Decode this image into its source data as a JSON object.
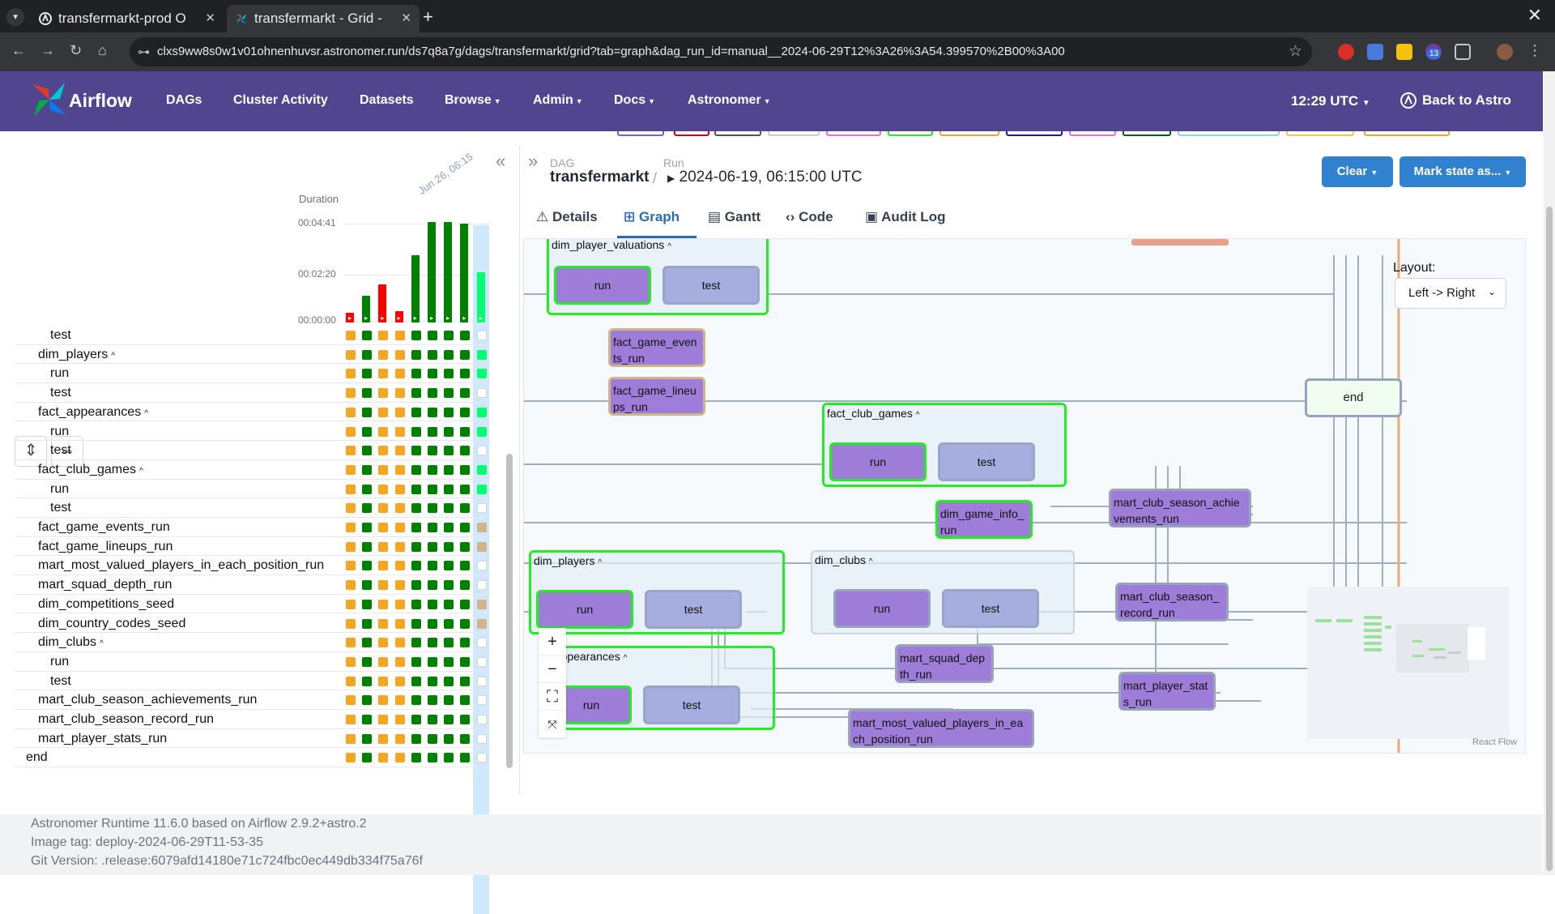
{
  "browser": {
    "tabs": [
      {
        "title": "transfermarkt-prod O"
      },
      {
        "title": "transfermarkt - Grid -"
      }
    ],
    "url": "clxs9ww8s0w1v01ohnenhuvsr.astronomer.run/ds7q8a7g/dags/transfermarkt/grid?tab=graph&dag_run_id=manual__2024-06-29T12%3A26%3A54.399570%2B00%3A00",
    "extension_badge": "13"
  },
  "nav": {
    "brand": "Airflow",
    "items": [
      "DAGs",
      "Cluster Activity",
      "Datasets",
      "Browse",
      "Admin",
      "Docs",
      "Astronomer"
    ],
    "dropdown_items": [
      "Browse",
      "Admin",
      "Docs",
      "Astronomer"
    ],
    "clock": "12:29 UTC",
    "back": "Back to Astro"
  },
  "grid": {
    "duration_label": "Duration",
    "ticks": [
      "00:04:41",
      "00:02:20",
      "00:00:00"
    ],
    "run_date": "Jun 26, 06:15",
    "bars": [
      {
        "state": "failed",
        "duration_fraction": 0.1
      },
      {
        "state": "success",
        "duration_fraction": 0.27
      },
      {
        "state": "failed",
        "duration_fraction": 0.38
      },
      {
        "state": "failed",
        "duration_fraction": 0.11
      },
      {
        "state": "success",
        "duration_fraction": 0.67
      },
      {
        "state": "success",
        "duration_fraction": 1.0
      },
      {
        "state": "success",
        "duration_fraction": 1.0
      },
      {
        "state": "success",
        "duration_fraction": 0.98
      },
      {
        "state": "running",
        "duration_fraction": 0.5
      }
    ],
    "rows": [
      {
        "label": "test",
        "indent": 2,
        "group": false,
        "states": [
          "U",
          "S",
          "U",
          "U",
          "S",
          "S",
          "S",
          "S",
          "N"
        ]
      },
      {
        "label": "dim_players",
        "indent": 1,
        "group": true,
        "states": [
          "U",
          "S",
          "U",
          "U",
          "S",
          "S",
          "S",
          "S",
          "R"
        ]
      },
      {
        "label": "run",
        "indent": 2,
        "group": false,
        "states": [
          "U",
          "S",
          "U",
          "U",
          "S",
          "S",
          "S",
          "S",
          "R"
        ]
      },
      {
        "label": "test",
        "indent": 2,
        "group": false,
        "states": [
          "U",
          "S",
          "U",
          "U",
          "S",
          "S",
          "S",
          "S",
          "N"
        ]
      },
      {
        "label": "fact_appearances",
        "indent": 1,
        "group": true,
        "states": [
          "U",
          "S",
          "U",
          "U",
          "S",
          "S",
          "S",
          "S",
          "R"
        ]
      },
      {
        "label": "run",
        "indent": 2,
        "group": false,
        "states": [
          "U",
          "S",
          "U",
          "U",
          "S",
          "S",
          "S",
          "S",
          "R"
        ]
      },
      {
        "label": "test",
        "indent": 2,
        "group": false,
        "states": [
          "U",
          "S",
          "U",
          "U",
          "S",
          "S",
          "S",
          "S",
          "N"
        ]
      },
      {
        "label": "fact_club_games",
        "indent": 1,
        "group": true,
        "states": [
          "U",
          "S",
          "U",
          "U",
          "S",
          "S",
          "S",
          "S",
          "R"
        ]
      },
      {
        "label": "run",
        "indent": 2,
        "group": false,
        "states": [
          "U",
          "S",
          "U",
          "U",
          "S",
          "S",
          "S",
          "S",
          "R"
        ]
      },
      {
        "label": "test",
        "indent": 2,
        "group": false,
        "states": [
          "U",
          "S",
          "U",
          "U",
          "S",
          "S",
          "S",
          "S",
          "N"
        ]
      },
      {
        "label": "fact_game_events_run",
        "indent": 1,
        "group": false,
        "states": [
          "U",
          "S",
          "U",
          "U",
          "S",
          "S",
          "S",
          "S",
          "T"
        ]
      },
      {
        "label": "fact_game_lineups_run",
        "indent": 1,
        "group": false,
        "states": [
          "U",
          "S",
          "U",
          "U",
          "S",
          "S",
          "S",
          "S",
          "T"
        ]
      },
      {
        "label": "mart_most_valued_players_in_each_position_run",
        "indent": 1,
        "group": false,
        "states": [
          "U",
          "S",
          "U",
          "U",
          "S",
          "S",
          "S",
          "S",
          "N"
        ]
      },
      {
        "label": "mart_squad_depth_run",
        "indent": 1,
        "group": false,
        "states": [
          "U",
          "S",
          "U",
          "U",
          "S",
          "S",
          "S",
          "S",
          "N"
        ]
      },
      {
        "label": "dim_competitions_seed",
        "indent": 1,
        "group": false,
        "states": [
          "U",
          "S",
          "U",
          "U",
          "S",
          "S",
          "S",
          "S",
          "T"
        ]
      },
      {
        "label": "dim_country_codes_seed",
        "indent": 1,
        "group": false,
        "states": [
          "U",
          "S",
          "U",
          "U",
          "S",
          "S",
          "S",
          "S",
          "T"
        ]
      },
      {
        "label": "dim_clubs",
        "indent": 1,
        "group": true,
        "states": [
          "U",
          "S",
          "U",
          "U",
          "S",
          "S",
          "S",
          "S",
          "N"
        ]
      },
      {
        "label": "run",
        "indent": 2,
        "group": false,
        "states": [
          "U",
          "S",
          "U",
          "U",
          "S",
          "S",
          "S",
          "S",
          "N"
        ]
      },
      {
        "label": "test",
        "indent": 2,
        "group": false,
        "states": [
          "U",
          "S",
          "U",
          "U",
          "S",
          "S",
          "S",
          "S",
          "N"
        ]
      },
      {
        "label": "mart_club_season_achievements_run",
        "indent": 1,
        "group": false,
        "states": [
          "U",
          "S",
          "U",
          "U",
          "S",
          "S",
          "S",
          "S",
          "N"
        ]
      },
      {
        "label": "mart_club_season_record_run",
        "indent": 1,
        "group": false,
        "states": [
          "U",
          "S",
          "U",
          "U",
          "S",
          "S",
          "S",
          "S",
          "N"
        ]
      },
      {
        "label": "mart_player_stats_run",
        "indent": 1,
        "group": false,
        "states": [
          "U",
          "S",
          "U",
          "U",
          "S",
          "S",
          "S",
          "S",
          "N"
        ]
      },
      {
        "label": "end",
        "indent": 0,
        "group": false,
        "states": [
          "U",
          "S",
          "U",
          "U",
          "S",
          "S",
          "S",
          "S",
          "N"
        ]
      }
    ]
  },
  "detail": {
    "dag_label": "DAG",
    "dag_name": "transfermarkt",
    "run_label": "Run",
    "run_value": "2024-06-19, 06:15:00 UTC",
    "clear_btn": "Clear",
    "mark_btn": "Mark state as...",
    "tabs": [
      "Details",
      "Graph",
      "Gantt",
      "Code",
      "Audit Log"
    ],
    "active_tab": "Graph"
  },
  "graph": {
    "layout_label": "Layout:",
    "layout_value": "Left -> Right",
    "groups": {
      "dim_player_valuations": "dim_player_valuations",
      "fact_club_games": "fact_club_games",
      "dim_players": "dim_players",
      "dim_clubs": "dim_clubs",
      "fact_appearances": "_appearances"
    },
    "tasks": {
      "run": "run",
      "test": "test",
      "fact_game_events_run": [
        "fact_game_even",
        "ts_run"
      ],
      "fact_game_lineups_run": [
        "fact_game_lineu",
        "ps_run"
      ],
      "dim_game_info_run": [
        "dim_game_info_",
        "run"
      ],
      "mart_club_season_achievements_run": [
        "mart_club_season_achie",
        "vements_run"
      ],
      "mart_club_season_record_run": [
        "mart_club_season_",
        "record_run"
      ],
      "mart_squad_depth_run": [
        "mart_squad_dep",
        "th_run"
      ],
      "mart_player_stats_run": [
        "mart_player_stat",
        "s_run"
      ],
      "mart_most_valued_players_in_each_position_run": [
        "mart_most_valued_players_in_ea",
        "ch_position_run"
      ],
      "end": "end"
    },
    "reactflow": "React Flow"
  },
  "footer": [
    "Astronomer Runtime 11.6.0 based on Airflow 2.9.2+astro.2",
    "Image tag: deploy-2024-06-29T11-53-35",
    "Git Version: .release:6079afd14180e71c724fbc0ec449db334f75a76f"
  ],
  "colors": {
    "nav_bg": "#51458f",
    "success": "#008000",
    "failed": "#ff0000",
    "upstream_failed": "#f5a623",
    "running": "#01ff70",
    "accent": "#3182ce"
  }
}
